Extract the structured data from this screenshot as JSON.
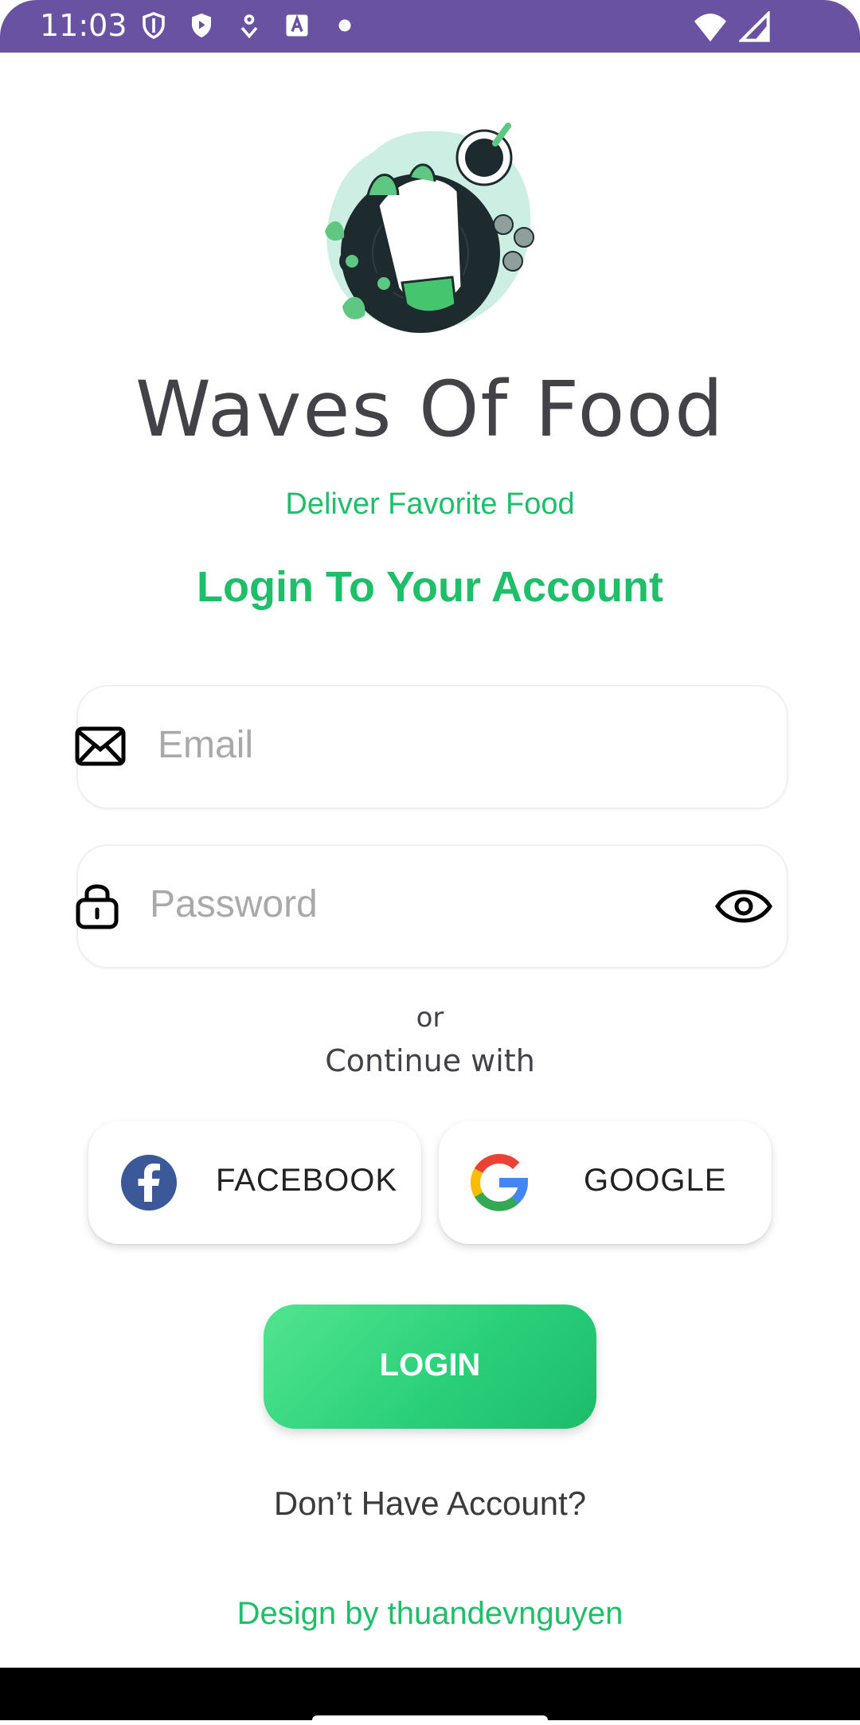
{
  "status_bar": {
    "time": "11:03",
    "left_icons": [
      "shield-icon",
      "play-protect-icon",
      "location-icon",
      "font-icon",
      "dot-icon"
    ],
    "right_icons": [
      "wifi-icon",
      "signal-icon"
    ]
  },
  "app": {
    "title": "Waves Of Food",
    "tagline": "Deliver Favorite Food",
    "headline": "Login To Your  Account"
  },
  "form": {
    "email_placeholder": "Email",
    "password_placeholder": "Password"
  },
  "social": {
    "or_text": "or",
    "continue_text": "Continue with",
    "facebook_label": "FACEBOOK",
    "google_label": "GOOGLE"
  },
  "actions": {
    "login_label": "LOGIN",
    "signup_label": "Don’t Have Account?"
  },
  "footer": {
    "credits": "Design by thuandevnguyen"
  },
  "colors": {
    "status_bar": "#6a52a3",
    "accent": "#1fbf6a",
    "title": "#424248"
  }
}
